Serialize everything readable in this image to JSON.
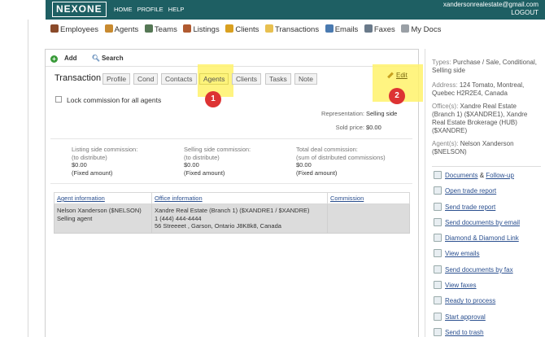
{
  "topbar": {
    "logo": "NEXONE",
    "nav": [
      "HOME",
      "PROFILE",
      "HELP"
    ],
    "user_email": "xandersonrealestate@gmail.com",
    "logout": "LOGOUT"
  },
  "main_nav": [
    {
      "label": "Employees",
      "icon": "people-icon",
      "color": "#8a4a2a"
    },
    {
      "label": "Agents",
      "icon": "agents-icon",
      "color": "#c88a30"
    },
    {
      "label": "Teams",
      "icon": "teams-icon",
      "color": "#557755"
    },
    {
      "label": "Listings",
      "icon": "house-icon",
      "color": "#b05a30"
    },
    {
      "label": "Clients",
      "icon": "client-icon",
      "color": "#d9a020"
    },
    {
      "label": "Transactions",
      "icon": "folder-icon",
      "color": "#e8c050"
    },
    {
      "label": "Emails",
      "icon": "envelope-icon",
      "color": "#4a7ab0"
    },
    {
      "label": "Faxes",
      "icon": "fax-icon",
      "color": "#6a7a8a"
    },
    {
      "label": "My Docs",
      "icon": "docs-icon",
      "color": "#9aa0a6"
    }
  ],
  "toolbar": {
    "add": "Add",
    "search": "Search"
  },
  "tabs": {
    "main": "Transaction",
    "items": [
      "Profile",
      "Cond",
      "Contacts",
      "Agents",
      "Clients",
      "Tasks",
      "Note"
    ],
    "selected": "Agents"
  },
  "edit_label": "Edit",
  "badges": [
    "1",
    "2"
  ],
  "lock_commission_label": "Lock commission for all agents",
  "representation": {
    "label": "Representation:",
    "value": "Selling side"
  },
  "sold_price": {
    "label": "Sold price:",
    "value": "$0.00"
  },
  "commissions": [
    {
      "title": "Listing side commission:",
      "sub": "(to distribute)",
      "amount": "$0.00",
      "type": "(Fixed amount)"
    },
    {
      "title": "Selling side commission:",
      "sub": "(to distribute)",
      "amount": "$0.00",
      "type": "(Fixed amount)"
    },
    {
      "title": "Total deal commission:",
      "sub": "(sum of distributed commissions)",
      "amount": "$0.00",
      "type": "(Fixed amount)"
    }
  ],
  "agents_table": {
    "headers": [
      "Agent information",
      "Office information",
      "Commission"
    ],
    "rows": [
      {
        "agent_name": "Nelson Xanderson ($NELSON)",
        "agent_role": "Selling agent",
        "office_name": "Xandre Real Estate (Branch 1) ($XANDRE1 / $XANDRE)",
        "office_phone": "1 (444) 444-4444",
        "office_address": "56 Streeeet , Garson, Ontario J8K8k8, Canada",
        "commission": ""
      }
    ]
  },
  "right_info": {
    "types": {
      "label": "Types:",
      "value": "Purchase / Sale, Conditional, Selling side"
    },
    "address": {
      "label": "Address:",
      "value": "124 Tomato, Montreal, Quebec H2R2E4, Canada"
    },
    "offices": {
      "label": "Office(s):",
      "value": "Xandre Real Estate (Branch 1) ($XANDRE1), Xandre Real Estate Brokerage (HUB) ($XANDRE)"
    },
    "agents": {
      "label": "Agent(s):",
      "value": "Nelson Xanderson ($NELSON)"
    }
  },
  "actions": [
    {
      "label": "Documents",
      "extra": "Follow-up",
      "icon": "document-icon"
    },
    {
      "label": "Open trade report",
      "icon": "report-icon"
    },
    {
      "label": "Send trade report",
      "icon": "send-report-icon"
    },
    {
      "label": "Send documents by email",
      "icon": "email-docs-icon"
    },
    {
      "label": "Diamond & Diamond Link",
      "icon": "link-icon"
    },
    {
      "label": "View emails",
      "icon": "view-emails-icon"
    },
    {
      "label": "Send documents by fax",
      "icon": "fax-docs-icon"
    },
    {
      "label": "View faxes",
      "icon": "view-faxes-icon"
    },
    {
      "label": "Ready to process",
      "icon": "process-icon"
    },
    {
      "label": "Start approval",
      "icon": "approval-icon"
    },
    {
      "label": "Send to trash",
      "icon": "trash-icon"
    }
  ]
}
